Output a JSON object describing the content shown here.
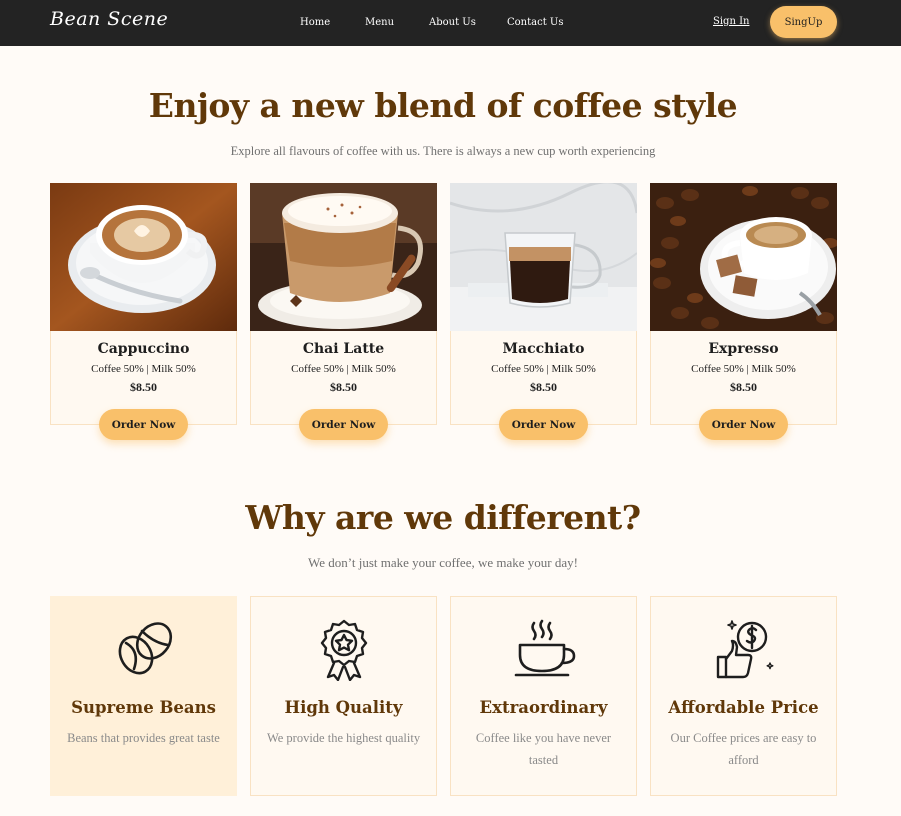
{
  "nav": {
    "logo": "Bean Scene",
    "links": [
      "Home",
      "Menu",
      "About Us",
      "Contact Us"
    ],
    "signin": "Sign In",
    "signup": "SingUp"
  },
  "hero": {
    "title": "Enjoy a new blend of coffee style",
    "subtitle": "Explore all flavours of coffee with us. There is always a new cup worth experiencing"
  },
  "products": [
    {
      "name": "Cappuccino",
      "mix": "Coffee 50% | Milk 50%",
      "price": "$8.50",
      "button": "Order Now"
    },
    {
      "name": "Chai Latte",
      "mix": "Coffee 50% | Milk 50%",
      "price": "$8.50",
      "button": "Order Now"
    },
    {
      "name": "Macchiato",
      "mix": "Coffee 50% | Milk 50%",
      "price": "$8.50",
      "button": "Order Now"
    },
    {
      "name": "Expresso",
      "mix": "Coffee 50% | Milk 50%",
      "price": "$8.50",
      "button": "Order Now"
    }
  ],
  "why": {
    "title": "Why are we different?",
    "subtitle": "We don’t just make your coffee, we make your day!"
  },
  "features": [
    {
      "title": "Supreme Beans",
      "desc": "Beans that provides great taste",
      "icon": "coffee-beans-icon"
    },
    {
      "title": "High Quality",
      "desc": "We provide the highest quality",
      "icon": "award-badge-icon"
    },
    {
      "title": "Extraordinary",
      "desc": "Coffee like you have never tasted",
      "icon": "coffee-cup-icon"
    },
    {
      "title": "Affordable Price",
      "desc": "Our Coffee prices are easy to afford",
      "icon": "thumbs-up-dollar-icon"
    }
  ],
  "colors": {
    "accent": "#f9c06a",
    "heading": "#603809",
    "navbar": "#232323",
    "page": "#fffbf7"
  }
}
